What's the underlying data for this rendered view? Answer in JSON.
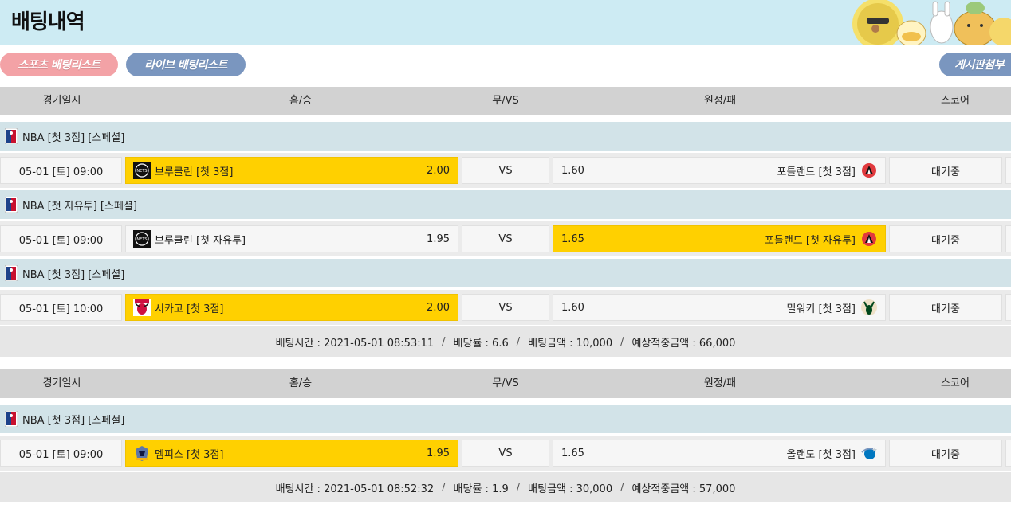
{
  "page": {
    "title": "배팅내역"
  },
  "tabs": {
    "sports": "스포츠 배팅리스트",
    "live": "라이브 배팅리스트",
    "board": "게시판첨부"
  },
  "columns": {
    "date": "경기일시",
    "home": "홈/승",
    "draw": "무/VS",
    "away": "원정/패",
    "score": "스코어"
  },
  "slips": [
    {
      "games": [
        {
          "league": "NBA [첫 3점] [스페셜]",
          "date": "05-01 [토] 09:00",
          "home": "브루클린 [첫 3점]",
          "home_odds": "2.00",
          "vs": "VS",
          "away_odds": "1.60",
          "away": "포틀랜드 [첫 3점]",
          "score": "대기중",
          "selected": "home",
          "home_logo": "nets-icon",
          "away_logo": "blazers-icon"
        },
        {
          "league": "NBA [첫 자유투] [스페셜]",
          "date": "05-01 [토] 09:00",
          "home": "브루클린 [첫 자유투]",
          "home_odds": "1.95",
          "vs": "VS",
          "away_odds": "1.65",
          "away": "포틀랜드 [첫 자유투]",
          "score": "대기중",
          "selected": "away",
          "home_logo": "nets-icon",
          "away_logo": "blazers-icon"
        },
        {
          "league": "NBA [첫 3점] [스페셜]",
          "date": "05-01 [토] 10:00",
          "home": "시카고 [첫 3점]",
          "home_odds": "2.00",
          "vs": "VS",
          "away_odds": "1.60",
          "away": "밀워키 [첫 3점]",
          "score": "대기중",
          "selected": "home",
          "home_logo": "bulls-icon",
          "away_logo": "bucks-icon"
        }
      ],
      "summary": {
        "time": "배팅시간 : 2021-05-01 08:53:11",
        "rate": "배당률 : 6.6",
        "amount": "배팅금액 : 10,000",
        "expected": "예상적중금액 : 66,000"
      }
    },
    {
      "games": [
        {
          "league": "NBA [첫 3점] [스페셜]",
          "date": "05-01 [토] 09:00",
          "home": "멤피스 [첫 3점]",
          "home_odds": "1.95",
          "vs": "VS",
          "away_odds": "1.65",
          "away": "올랜도 [첫 3점]",
          "score": "대기중",
          "selected": "home",
          "home_logo": "grizzlies-icon",
          "away_logo": "magic-icon"
        }
      ],
      "summary": {
        "time": "배팅시간 : 2021-05-01 08:52:32",
        "rate": "배당률 : 1.9",
        "amount": "배팅금액 : 30,000",
        "expected": "예상적중금액 : 57,000"
      }
    }
  ],
  "colors": {
    "header_bg": "#cdebf3",
    "selected": "#ffd000",
    "group_bg": "#d2e3e8",
    "thead_bg": "#d2d2d2",
    "pill_pink": "#f3a2a6",
    "pill_blue": "#7a96bf"
  }
}
